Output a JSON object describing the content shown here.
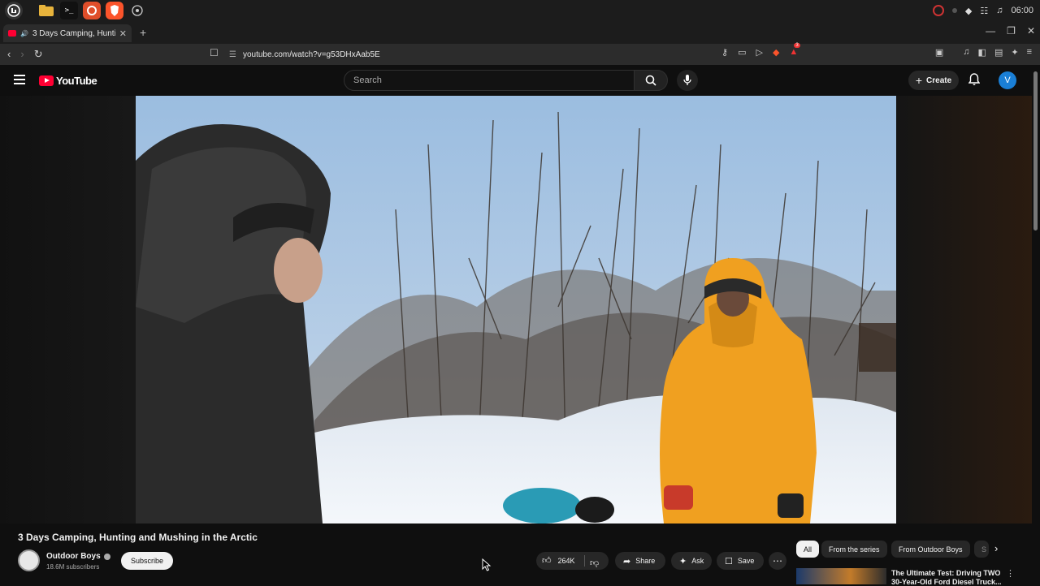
{
  "taskbar": {
    "apps": [
      "mint-menu",
      "files",
      "terminal",
      "firefox",
      "brave",
      "settings"
    ],
    "clock": "06:00"
  },
  "browser": {
    "tab_title": "3 Days Camping, Hunting",
    "url": "youtube.com/watch?v=g53DHxAab5E",
    "new_tab": "+",
    "shield_count": "3"
  },
  "youtube": {
    "logo_text": "YouTube",
    "search_placeholder": "Search",
    "create_label": "Create",
    "avatar_letter": "V"
  },
  "video": {
    "title": "3 Days Camping, Hunting and Mushing in the Arctic",
    "channel": "Outdoor Boys",
    "subscribers": "18.6M subscribers",
    "subscribe_label": "Subscribe",
    "likes": "264K",
    "share_label": "Share",
    "ask_label": "Ask",
    "save_label": "Save"
  },
  "sidebar": {
    "chips": [
      "All",
      "From the series",
      "From Outdoor Boys",
      "S"
    ],
    "recommendation": {
      "title_line1": "The Ultimate Test: Driving TWO",
      "title_line2": "30-Year-Old Ford Diesel Truck..."
    }
  },
  "colors": {
    "yt_red": "#ff0033",
    "bg": "#0f0f0f",
    "chip_bg": "#272727",
    "avatar": "#1a7fd6",
    "jacket_orange": "#f0a020"
  }
}
